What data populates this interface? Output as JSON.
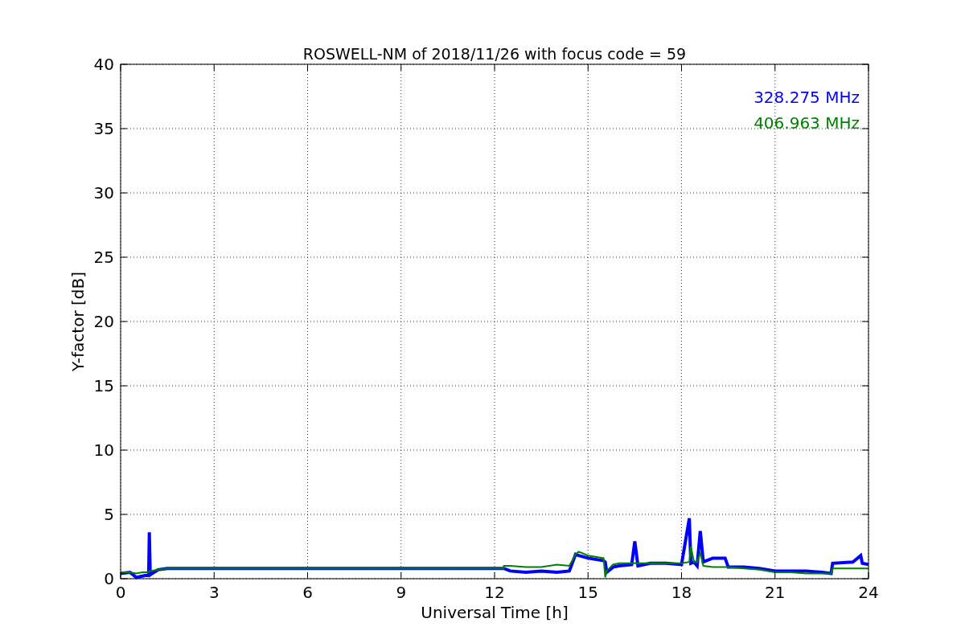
{
  "chart_data": {
    "type": "line",
    "title": "ROSWELL-NM of 2018/11/26 with focus code = 59",
    "xlabel": "Universal Time [h]",
    "ylabel": "Y-factor [dB]",
    "grid": true,
    "x": [
      0,
      0.3,
      0.5,
      0.7,
      0.9,
      0.92,
      0.95,
      1.2,
      1.5,
      12.29,
      12.3,
      12.5,
      13,
      13.5,
      14,
      14.4,
      14.6,
      14.7,
      15,
      15.5,
      15.55,
      15.6,
      15.8,
      16,
      16.4,
      16.5,
      16.6,
      17,
      17.5,
      18,
      18.25,
      18.3,
      18.4,
      18.5,
      18.6,
      18.7,
      19,
      19.4,
      19.5,
      20,
      20.5,
      21,
      21.5,
      22,
      22.5,
      22.8,
      22.85,
      23.5,
      23.75,
      23.8,
      24
    ],
    "series": [
      {
        "name": "328.275 MHz",
        "color": "#0000ff",
        "values": [
          0.4,
          0.5,
          0.1,
          0.2,
          0.3,
          3.6,
          0.3,
          0.7,
          0.8,
          0.8,
          0.8,
          0.6,
          0.5,
          0.6,
          0.5,
          0.6,
          1.9,
          1.8,
          1.6,
          1.4,
          1.3,
          0.5,
          0.9,
          1.0,
          1.1,
          2.9,
          1.0,
          1.2,
          1.2,
          1.1,
          4.7,
          1.2,
          1.3,
          1.0,
          3.7,
          1.3,
          1.6,
          1.6,
          0.9,
          0.9,
          0.8,
          0.6,
          0.6,
          0.6,
          0.5,
          0.4,
          1.2,
          1.3,
          1.8,
          1.2,
          1.1
        ]
      },
      {
        "name": "406.963 MHz",
        "color": "#008000",
        "values": [
          0.5,
          0.5,
          0.4,
          0.5,
          0.5,
          0.6,
          0.6,
          0.7,
          0.8,
          0.8,
          1.0,
          1.0,
          0.9,
          0.9,
          1.1,
          1.0,
          1.9,
          2.1,
          1.8,
          1.6,
          0.1,
          0.6,
          1.1,
          1.2,
          1.2,
          1.2,
          1.2,
          1.2,
          1.2,
          1.2,
          1.3,
          2.5,
          1.3,
          1.3,
          2.0,
          1.0,
          0.9,
          0.9,
          0.9,
          0.8,
          0.7,
          0.5,
          0.5,
          0.4,
          0.4,
          0.4,
          0.8,
          0.8,
          0.8,
          0.8,
          0.8
        ]
      }
    ],
    "xlim": [
      0,
      24
    ],
    "ylim": [
      0,
      40
    ],
    "xticks": [
      0,
      3,
      6,
      9,
      12,
      15,
      18,
      21,
      24
    ],
    "yticks": [
      0,
      5,
      10,
      15,
      20,
      25,
      30,
      35,
      40
    ]
  }
}
